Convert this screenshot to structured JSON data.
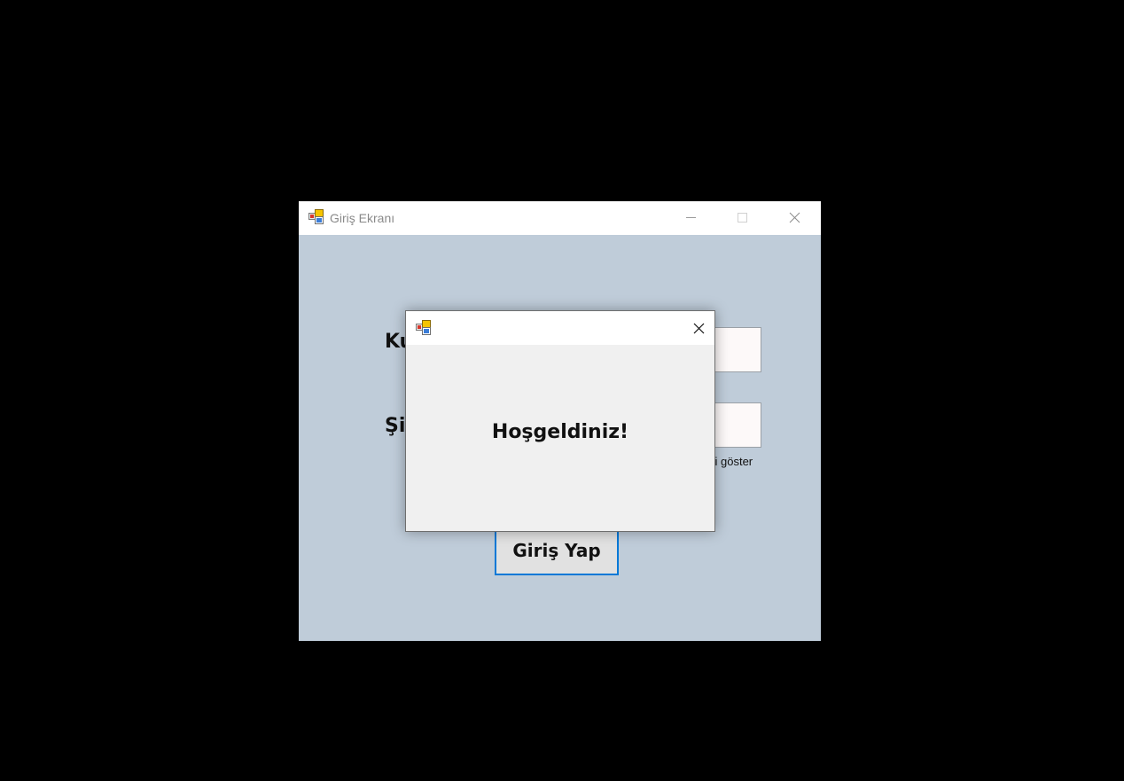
{
  "main_window": {
    "title": "Giriş Ekranı",
    "icon": "windows-forms-app-icon",
    "controls": [
      "minimize-icon",
      "maximize-icon",
      "close-icon"
    ],
    "background_color": "#bfccd9",
    "labels": {
      "username_visible": "Ku",
      "password_visible": "Şi"
    },
    "username_input": {
      "value": ""
    },
    "password_input": {
      "value": ""
    },
    "show_password_visible": "yi göster",
    "login_button_label": "Giriş Yap",
    "accent_color": "#0078d7"
  },
  "dialog": {
    "title": "",
    "icon": "windows-forms-app-icon",
    "message": "Hoşgeldiniz!",
    "close_icon": "close-icon"
  }
}
